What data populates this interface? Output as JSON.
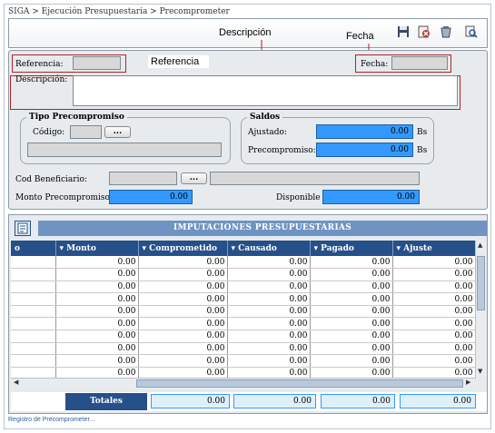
{
  "breadcrumb": "SIGA > Ejecución Presupuestaria > Precomprometer",
  "callouts": {
    "descripcion": "Descripción",
    "fecha": "Fecha",
    "referencia": "Referencia"
  },
  "toolbar": {
    "icons": [
      "save-icon",
      "cancel-icon",
      "delete-icon",
      "search-icon"
    ]
  },
  "form": {
    "referencia_label": "Referencia:",
    "referencia_value": "",
    "fecha_label": "Fecha:",
    "fecha_value": "",
    "descripcion_label": "Descripción:",
    "descripcion_value": "",
    "tipo_group_title": "Tipo Precompromiso",
    "codigo_label": "Código:",
    "dots_label": "...",
    "saldos_group_title": "Saldos",
    "ajustado_label": "Ajustado:",
    "ajustado_value": "0.00",
    "ajustado_unit": "Bs",
    "precompromiso_label": "Precompromiso:",
    "precompromiso_value": "0.00",
    "precompromiso_unit": "Bs",
    "cod_beneficiario_label": "Cod Beneficiario:",
    "monto_precompromiso_label": "Monto Precompromiso:",
    "monto_precompromiso_value": "0.00",
    "disponible_label": "Disponible",
    "disponible_value": "0.00"
  },
  "grid": {
    "title": "IMPUTACIONES PRESUPUESTARIAS",
    "columns": [
      "o",
      "Monto",
      "Comprometido",
      "Causado",
      "Pagado",
      "Ajuste"
    ],
    "rows": [
      [
        "",
        "0.00",
        "0.00",
        "0.00",
        "0.00",
        "0.00"
      ],
      [
        "",
        "0.00",
        "0.00",
        "0.00",
        "0.00",
        "0.00"
      ],
      [
        "",
        "0.00",
        "0.00",
        "0.00",
        "0.00",
        "0.00"
      ],
      [
        "",
        "0.00",
        "0.00",
        "0.00",
        "0.00",
        "0.00"
      ],
      [
        "",
        "0.00",
        "0.00",
        "0.00",
        "0.00",
        "0.00"
      ],
      [
        "",
        "0.00",
        "0.00",
        "0.00",
        "0.00",
        "0.00"
      ],
      [
        "",
        "0.00",
        "0.00",
        "0.00",
        "0.00",
        "0.00"
      ],
      [
        "",
        "0.00",
        "0.00",
        "0.00",
        "0.00",
        "0.00"
      ],
      [
        "",
        "0.00",
        "0.00",
        "0.00",
        "0.00",
        "0.00"
      ],
      [
        "",
        "0.00",
        "0.00",
        "0.00",
        "0.00",
        "0.00"
      ]
    ],
    "totales_label": "Totales",
    "totals": [
      "0.00",
      "0.00",
      "0.00",
      "0.00"
    ]
  },
  "status_text": "Registro de Precomprometer...",
  "colors": {
    "header_dark_blue": "#26508a",
    "title_bar_blue": "#6f94c3",
    "value_blue": "#3399ff",
    "annotation_red": "#b22222"
  }
}
